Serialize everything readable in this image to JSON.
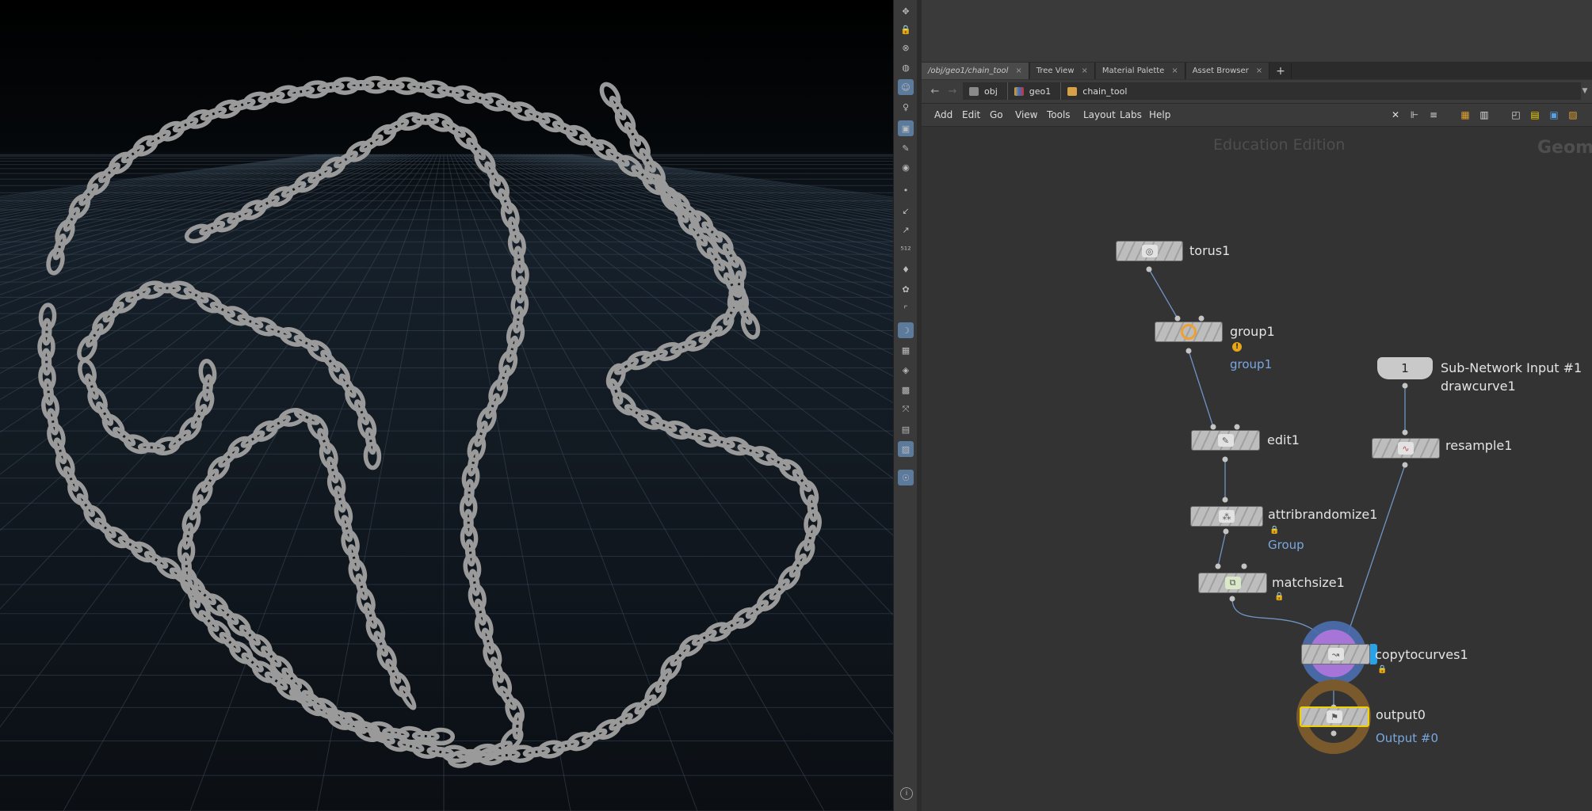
{
  "path_tab": {
    "label": "/obj/geo1/chain_tool",
    "close": "×"
  },
  "tabs": [
    {
      "label": "Tree View",
      "close": "×"
    },
    {
      "label": "Material Palette",
      "close": "×"
    },
    {
      "label": "Asset Browser",
      "close": "×"
    }
  ],
  "add_tab": "+",
  "breadcrumb": {
    "obj": "obj",
    "geo1": "geo1",
    "chain_tool": "chain_tool"
  },
  "menu": {
    "add": "Add",
    "edit": "Edit",
    "go": "Go",
    "view": "View",
    "tools": "Tools",
    "layout": "Layout",
    "labs": "Labs",
    "help": "Help"
  },
  "network": {
    "watermark": "Education Edition",
    "context_label": "Geome",
    "nodes": {
      "torus1": "torus1",
      "group1": "group1",
      "group1_sub": "group1",
      "edit1": "edit1",
      "attribrandomize1": "attribrandomize1",
      "attribrandomize1_sub": "Group",
      "matchsize1": "matchsize1",
      "subnet_input_number": "1",
      "subnet_input_label": "Sub-Network Input #1",
      "subnet_input_sub": "drawcurve1",
      "resample1": "resample1",
      "copytocurves1": "copytocurves1",
      "output0": "output0",
      "output0_sub": "Output #0"
    }
  },
  "colors": {
    "viewport_bg": "#000000",
    "grid_line": "#3b4a5a",
    "chain_link": "#9a9a9a",
    "node_sub_text": "#79a8e0",
    "selected_node_border": "#f0d000",
    "shelf_active": "#5b7a9c"
  },
  "icons": {
    "back": "←",
    "forward": "→",
    "info": "i"
  }
}
